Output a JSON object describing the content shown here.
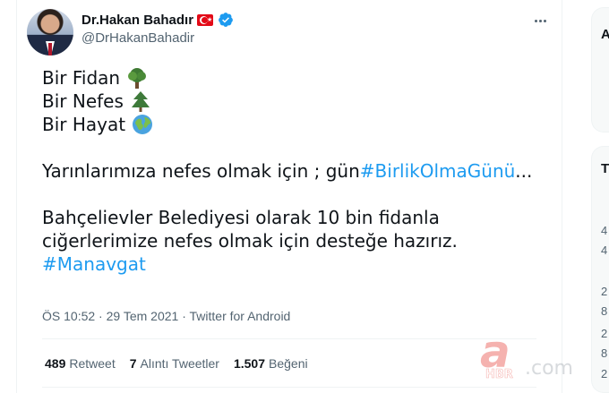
{
  "author": {
    "display_name": "Dr.Hakan Bahadır",
    "handle": "@DrHakanBahadir"
  },
  "icons": {
    "flag": "turkey-flag-icon",
    "verified": "verified-badge-icon",
    "more": "more-options-icon",
    "tree": "deciduous-tree-icon",
    "pine": "evergreen-tree-icon",
    "globe": "globe-icon"
  },
  "tweet": {
    "line1": "Bir Fidan",
    "line2": "Bir Nefes",
    "line3": "Bir Hayat",
    "line4_text": "Yarınlarımıza nefes olmak için ; gün ",
    "line4_hashtag": "#BirlikOlmaGünü",
    "line4_ellipsis": "...",
    "line5": "Bahçelievler Belediyesi olarak 10 bin fidanla",
    "line6": "ciğerlerimize nefes olmak için desteğe hazırız.",
    "line7_hashtag": "#Manavgat"
  },
  "meta": {
    "time": "ÖS 10:52",
    "separator": " · ",
    "date": "29 Tem 2021",
    "source": "Twitter for Android"
  },
  "stats": {
    "retweets_count": "489",
    "retweets_label": "Retweet",
    "quotes_count": "7",
    "quotes_label": "Alıntı Tweetler",
    "likes_count": "1.507",
    "likes_label": "Beğeni"
  },
  "watermark": {
    "brand": "a",
    "sub": "HBR",
    "domain": ".com.tr"
  },
  "sidebar": {
    "chars": [
      "4",
      "4",
      "2",
      "8",
      "2",
      "8",
      "2"
    ]
  },
  "colors": {
    "accent": "#1d9bf0",
    "text_primary": "#0f1419",
    "text_secondary": "#536471",
    "flag_red": "#e30a17",
    "watermark_red": "#e2231a"
  }
}
